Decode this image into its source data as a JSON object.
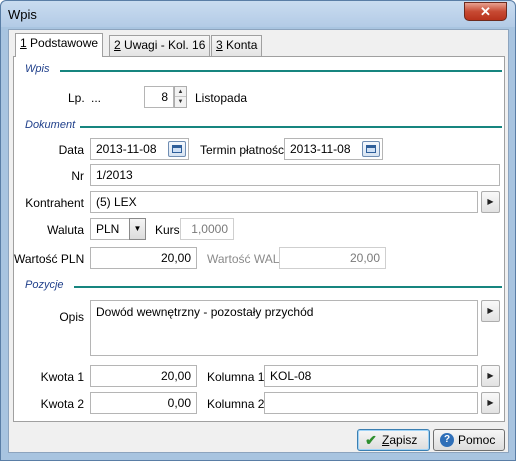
{
  "window": {
    "title": "Wpis"
  },
  "tabs": [
    {
      "key": "1",
      "label": " Podstawowe"
    },
    {
      "key": "2",
      "label": " Uwagi - Kol. 16"
    },
    {
      "key": "3",
      "label": " Konta"
    }
  ],
  "sections": {
    "wpis": "Wpis",
    "dokument": "Dokument",
    "pozycje": "Pozycje"
  },
  "wpis": {
    "lp_label": "Lp.",
    "lp_value": "...",
    "number": "8",
    "month": "Listopada"
  },
  "dokument": {
    "data_label": "Data",
    "data_value": "2013-11-08",
    "termin_label": "Termin płatności",
    "termin_value": "2013-11-08",
    "nr_label": "Nr",
    "nr_value": "1/2013",
    "kontrahent_label": "Kontrahent",
    "kontrahent_value": "(5) LEX",
    "waluta_label": "Waluta",
    "waluta_value": "PLN",
    "kurs_label": "Kurs",
    "kurs_value": "1,0000",
    "wartosc_pln_label": "Wartość PLN",
    "wartosc_pln_value": "20,00",
    "wartosc_wal_label": "Wartość WAL",
    "wartosc_wal_value": "20,00"
  },
  "pozycje": {
    "opis_label": "Opis",
    "opis_value": "Dowód wewnętrzny - pozostały przychód",
    "kwota1_label": "Kwota 1",
    "kwota1_value": "20,00",
    "kolumna1_label": "Kolumna 1",
    "kolumna1_value": "KOL-08",
    "kwota2_label": "Kwota 2",
    "kwota2_value": "0,00",
    "kolumna2_label": "Kolumna 2",
    "kolumna2_value": ""
  },
  "buttons": {
    "zapisz_key": "Z",
    "zapisz_rest": "apisz",
    "pomoc": "Pomoc"
  },
  "icons": {
    "close": "close-icon",
    "calendar": "calendar-icon",
    "arrow": "arrow-right-icon",
    "save": "check-icon",
    "help": "help-icon"
  }
}
